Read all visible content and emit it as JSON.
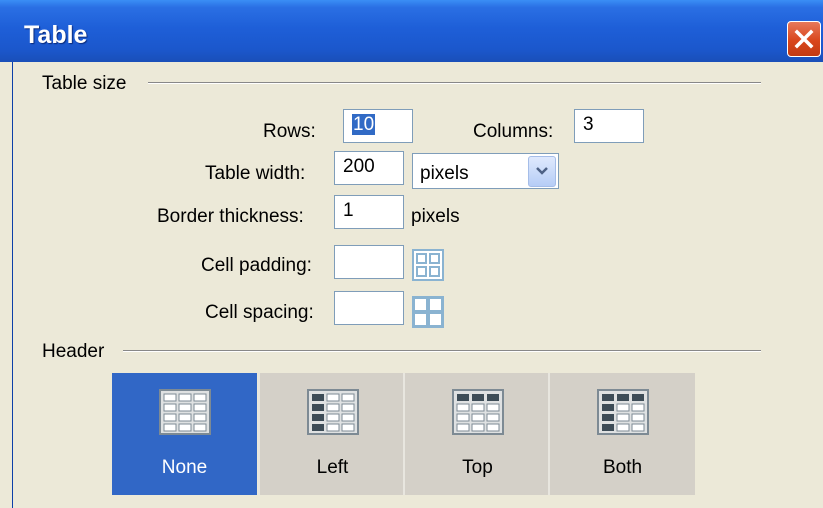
{
  "window": {
    "title": "Table"
  },
  "table_size": {
    "legend": "Table size",
    "rows_label": "Rows:",
    "rows_value": "10",
    "columns_label": "Columns:",
    "columns_value": "3",
    "width_label": "Table width:",
    "width_value": "200",
    "width_unit": "pixels",
    "border_label": "Border thickness:",
    "border_value": "1",
    "border_unit": "pixels",
    "padding_label": "Cell padding:",
    "padding_value": "",
    "spacing_label": "Cell spacing:",
    "spacing_value": ""
  },
  "header": {
    "legend": "Header",
    "options": [
      {
        "label": "None",
        "selected": true
      },
      {
        "label": "Left",
        "selected": false
      },
      {
        "label": "Top",
        "selected": false
      },
      {
        "label": "Both",
        "selected": false
      }
    ]
  },
  "colors": {
    "title_bar": "#1e5fd8",
    "selected_option": "#3167c6",
    "close_button": "#d9461c",
    "dialog_bg": "#ece9d8"
  }
}
